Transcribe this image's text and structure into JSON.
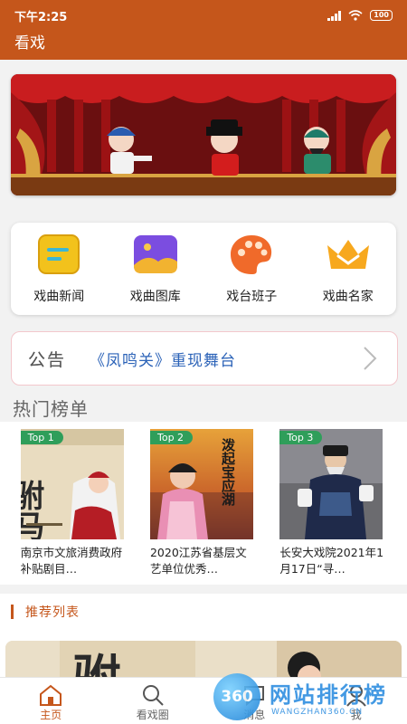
{
  "status": {
    "time": "下午2:25",
    "battery": "100"
  },
  "app": {
    "title": "看戏"
  },
  "categories": [
    {
      "label": "戏曲新闻",
      "icon": "news-icon"
    },
    {
      "label": "戏曲图库",
      "icon": "gallery-icon"
    },
    {
      "label": "戏台班子",
      "icon": "palette-icon"
    },
    {
      "label": "戏曲名家",
      "icon": "crown-icon"
    }
  ],
  "notice": {
    "label": "公告",
    "text": "《凤鸣关》重现舞台"
  },
  "hot": {
    "title": "热门榜单",
    "items": [
      {
        "badge": "Top 1",
        "caption": "南京市文旅消费政府补贴剧目…",
        "art_text": "驸马"
      },
      {
        "badge": "Top 2",
        "caption": "2020江苏省基层文艺单位优秀…",
        "art_text": "泼起宝应湖"
      },
      {
        "badge": "Top 3",
        "caption": "长安大戏院2021年1月17日“寻…"
      }
    ]
  },
  "recommend": {
    "title": "推荐列表",
    "art_text": "驸"
  },
  "tabs": [
    {
      "label": "主页",
      "icon": "home-icon"
    },
    {
      "label": "看戏圈",
      "icon": "search-icon"
    },
    {
      "label": "消息",
      "icon": "message-icon"
    },
    {
      "label": "我",
      "icon": "user-icon"
    }
  ],
  "watermark": {
    "logo": "360",
    "name": "网站排行榜",
    "url": "WANGZHAN360.CN"
  },
  "colors": {
    "primary": "#c5561b",
    "link": "#2c63b8",
    "badge": "#2f9e5a"
  }
}
